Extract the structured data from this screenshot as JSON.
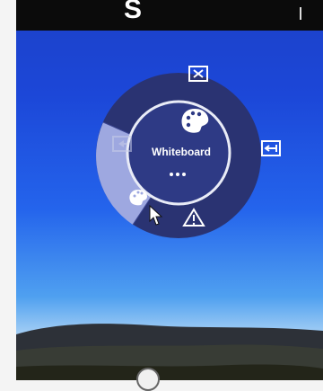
{
  "top_bar": {
    "letter": "S"
  },
  "radial_menu": {
    "center": {
      "label": "Whiteboard",
      "icon": "palette-icon",
      "more": "•••"
    },
    "items": [
      {
        "name": "close",
        "icon": "close-box-icon"
      },
      {
        "name": "exit-right",
        "icon": "exit-box-icon"
      },
      {
        "name": "warning",
        "icon": "warning-icon"
      },
      {
        "name": "whiteboard",
        "icon": "palette-icon",
        "highlighted": true
      },
      {
        "name": "back",
        "icon": "back-box-icon",
        "disabled": true
      }
    ]
  },
  "colors": {
    "menu_dark": "#2a3372",
    "menu_ring": "#313c86",
    "highlight": "#9ea8e0",
    "screen_blue": "#1f4ee0"
  }
}
